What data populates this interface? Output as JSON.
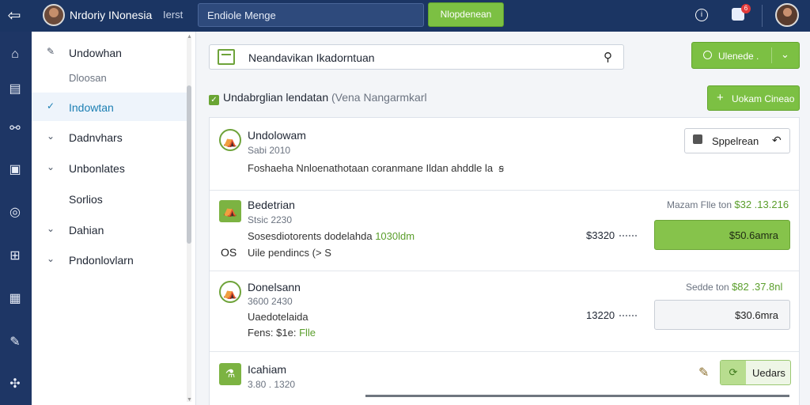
{
  "topbar": {
    "brand": "Nrdoriy INonesia",
    "sub": "Ierst",
    "search_placeholder": "Endiole Menge",
    "cta_label": "Nlopdenean",
    "info_glyph": "i",
    "notification_count": "6"
  },
  "rail": {
    "icons": [
      "home-icon",
      "document-icon",
      "share-icon",
      "image-icon",
      "compass-icon",
      "layout-icon",
      "folder-icon",
      "pen-icon",
      "puzzle-icon"
    ]
  },
  "sidebar": {
    "items": [
      {
        "chev": "✎",
        "label": "Undowhan"
      },
      {
        "chev": "",
        "label": "Dloosan"
      },
      {
        "chev": "✓",
        "label": "Indowtan"
      },
      {
        "chev": "⌄",
        "label": "Dadnvhars"
      },
      {
        "chev": "⌄",
        "label": "Unbonlates"
      },
      {
        "chev": "",
        "label": "Sorlios"
      },
      {
        "chev": "⌄",
        "label": "Dahian"
      },
      {
        "chev": "⌄",
        "label": "Pndonlovlarn"
      }
    ]
  },
  "main": {
    "search_value": "Neandavikan Ikadorntuan",
    "top_dropdown_label": "Ulenede .",
    "add_button_label": "Uokam Cineao",
    "filter_label": "Undabrglian lendatan",
    "filter_sub": "(Vena Nangarmkarl"
  },
  "rows": [
    {
      "title": "Undolowam",
      "meta": "Sabi  2010",
      "line": "Foshaeha Nnloenathotaan coranmane Ildan ahddle  la",
      "line_extra": "ꞩ",
      "button": "Sppelrean",
      "button_icon": "↶"
    },
    {
      "title": "Bedetrian",
      "meta": "Stsic 2230",
      "line": "Sosesdiotorents dodelahda",
      "line_green": "1030ldm",
      "line2": "Uile pendincs  (>  S",
      "side_label": "OS",
      "range_label": "Mazam Flle  ton",
      "range_value": "$32 .13.216",
      "amount": "$3320",
      "button": "$50.6amra"
    },
    {
      "title": "Donelsann",
      "meta": "3600  2430",
      "line": "Uaedotelaida",
      "line2": "Fens: $1e:",
      "line2_green": "Flle",
      "range_label": "Sedde  ton",
      "range_value": "$82 .37.8nl",
      "amount": "13220",
      "button": "$30.6mra"
    },
    {
      "title": "Icahiam",
      "meta": "3.80 . 1320",
      "button": "Uedars"
    }
  ]
}
